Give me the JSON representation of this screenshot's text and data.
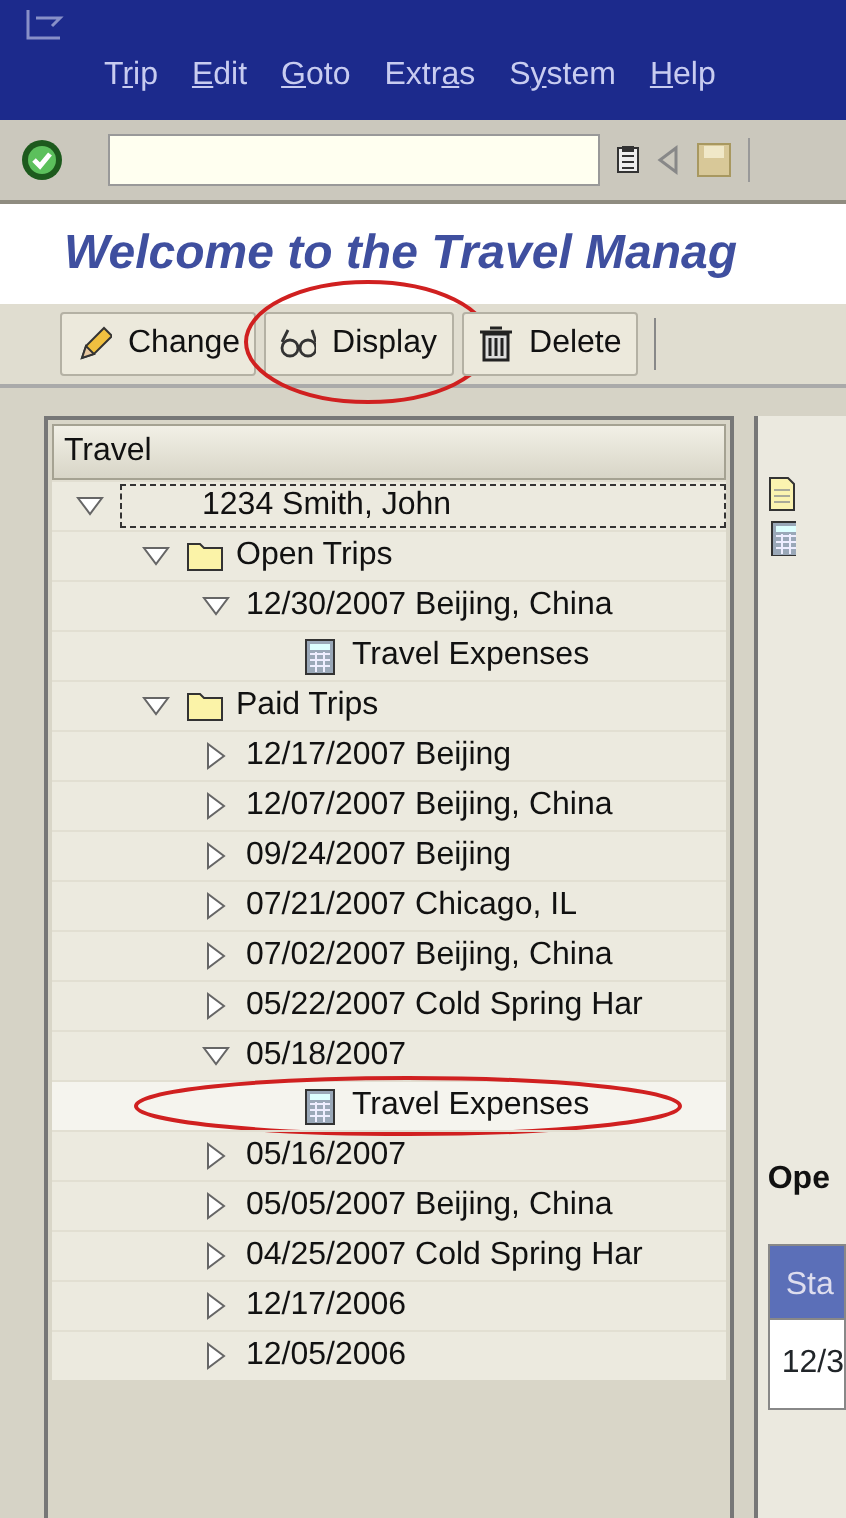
{
  "menu": [
    {
      "before": "T",
      "underlined": "r",
      "after": "ip"
    },
    {
      "underlined": "E",
      "after": "dit"
    },
    {
      "underlined": "G",
      "after": "oto"
    },
    {
      "before": "Extr",
      "underlined": "a",
      "after": "s"
    },
    {
      "before": "S",
      "underlined": "y",
      "after": "stem"
    },
    {
      "underlined": "H",
      "after": "elp"
    }
  ],
  "title": "Welcome to the Travel Manag",
  "toolbar": [
    {
      "label": "Change",
      "kind": "edit",
      "circled": false
    },
    {
      "label": "Display",
      "kind": "view",
      "circled": true
    },
    {
      "label": "Delete",
      "kind": "remove",
      "circled": false
    }
  ],
  "tree": {
    "header": "Travel",
    "nodes": [
      {
        "label": "1234 Smith, John",
        "expanded": true,
        "focused": true,
        "children": [
          {
            "label": "Open Trips",
            "kind": "group",
            "expanded": true,
            "children": [
              {
                "label": "12/30/2007 Beijing, China",
                "expanded": true,
                "children": [
                  {
                    "label": "Travel Expenses",
                    "kind": "expenses",
                    "circled": false
                  }
                ]
              }
            ]
          },
          {
            "label": "Paid Trips",
            "kind": "group",
            "expanded": true,
            "children": [
              {
                "label": "12/17/2007 Beijing",
                "expanded": false
              },
              {
                "label": "12/07/2007 Beijing, China",
                "expanded": false
              },
              {
                "label": "09/24/2007 Beijing",
                "expanded": false
              },
              {
                "label": "07/21/2007 Chicago, IL",
                "expanded": false
              },
              {
                "label": "07/02/2007 Beijing, China",
                "expanded": false
              },
              {
                "label": "05/22/2007 Cold Spring Har",
                "expanded": false
              },
              {
                "label": "05/18/2007",
                "expanded": true,
                "children": [
                  {
                    "label": "Travel Expenses",
                    "kind": "expenses",
                    "circled": true
                  }
                ]
              },
              {
                "label": "05/16/2007",
                "expanded": false
              },
              {
                "label": "05/05/2007 Beijing, China",
                "expanded": false
              },
              {
                "label": "04/25/2007 Cold Spring Har",
                "expanded": false
              },
              {
                "label": "12/17/2006",
                "expanded": false
              },
              {
                "label": "12/05/2006",
                "expanded": false
              }
            ]
          }
        ]
      }
    ]
  },
  "right": {
    "heading": "Ope",
    "table": {
      "columns": [
        "Sta"
      ],
      "rows": [
        [
          "12/3"
        ]
      ]
    }
  }
}
